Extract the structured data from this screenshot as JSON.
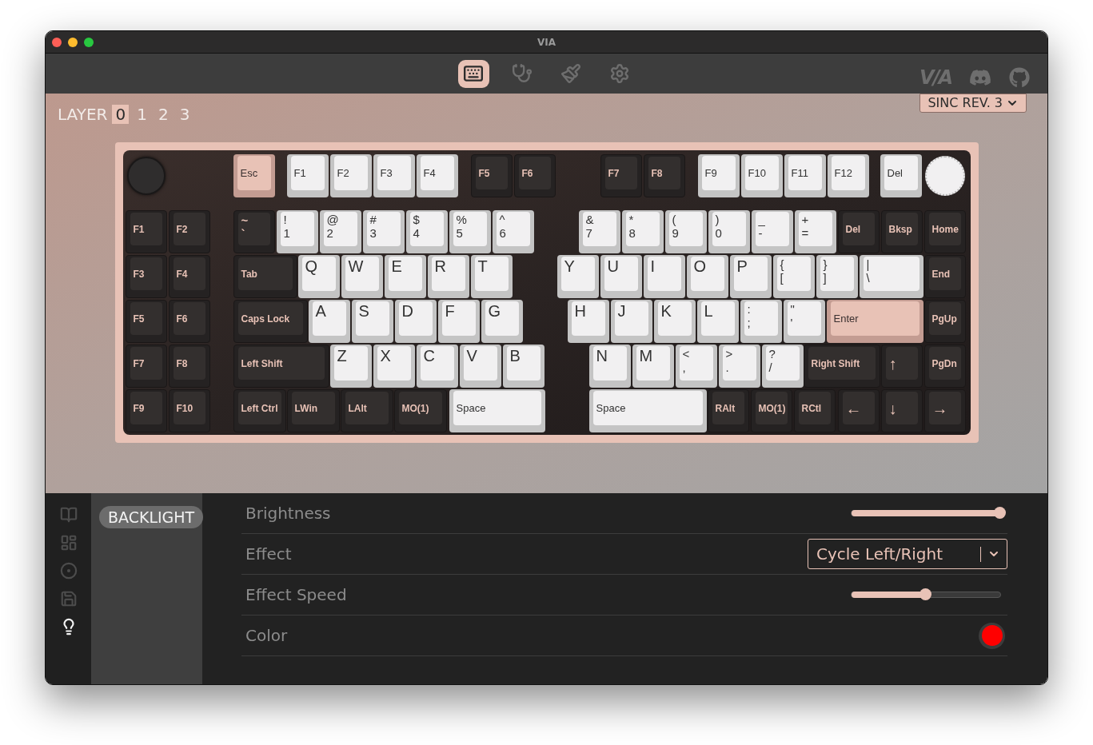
{
  "window": {
    "title": "VIA"
  },
  "nav": {
    "tabs": [
      {
        "kind": "keyboard",
        "selected": true
      },
      {
        "kind": "stethoscope",
        "selected": false
      },
      {
        "kind": "brush",
        "selected": false
      },
      {
        "kind": "settings",
        "selected": false
      }
    ],
    "logo": "V/A"
  },
  "layers": {
    "label": "LAYER",
    "items": [
      {
        "label": "0",
        "selected": true
      },
      {
        "label": "1",
        "selected": false
      },
      {
        "label": "2",
        "selected": false
      },
      {
        "label": "3",
        "selected": false
      }
    ]
  },
  "device": {
    "label": "SINC REV. 3"
  },
  "keyboard": {
    "rows": [
      {
        "keys": [
          {
            "kind": "accent",
            "legends": [
              "Esc"
            ]
          },
          {
            "kind": "light",
            "legends": [
              "F1"
            ]
          },
          {
            "kind": "light",
            "legends": [
              "F2"
            ]
          },
          {
            "kind": "light",
            "legends": [
              "F3"
            ]
          },
          {
            "kind": "light",
            "legends": [
              "F4"
            ]
          },
          {
            "kind": "dark",
            "legends": [
              "F5"
            ]
          },
          {
            "kind": "dark",
            "legends": [
              "F6"
            ]
          },
          {
            "kind": "dark",
            "legends": [
              "F7"
            ]
          },
          {
            "kind": "dark",
            "legends": [
              "F8"
            ]
          },
          {
            "kind": "light",
            "legends": [
              "F9"
            ]
          },
          {
            "kind": "light",
            "legends": [
              "F10"
            ]
          },
          {
            "kind": "light",
            "legends": [
              "F11"
            ]
          },
          {
            "kind": "light",
            "legends": [
              "F12"
            ]
          },
          {
            "kind": "light",
            "legends": [
              "Del"
            ]
          }
        ]
      },
      {
        "keys": [
          {
            "kind": "dark",
            "legends": [
              "F1"
            ]
          },
          {
            "kind": "dark",
            "legends": [
              "F2"
            ]
          },
          {
            "kind": "dark",
            "legends": [
              "~",
              "`"
            ]
          },
          {
            "kind": "light",
            "legends": [
              "!",
              "1"
            ]
          },
          {
            "kind": "light",
            "legends": [
              "@",
              "2"
            ]
          },
          {
            "kind": "light",
            "legends": [
              "#",
              "3"
            ]
          },
          {
            "kind": "light",
            "legends": [
              "$",
              "4"
            ]
          },
          {
            "kind": "light",
            "legends": [
              "%",
              "5"
            ]
          },
          {
            "kind": "light",
            "legends": [
              "^",
              "6"
            ]
          },
          {
            "kind": "light",
            "legends": [
              "&",
              "7"
            ]
          },
          {
            "kind": "light",
            "legends": [
              "*",
              "8"
            ]
          },
          {
            "kind": "light",
            "legends": [
              "(",
              "9"
            ]
          },
          {
            "kind": "light",
            "legends": [
              ")",
              "0"
            ]
          },
          {
            "kind": "light",
            "legends": [
              "_",
              "-"
            ]
          },
          {
            "kind": "light",
            "legends": [
              "+",
              "="
            ]
          },
          {
            "kind": "dark",
            "legends": [
              "Del"
            ]
          },
          {
            "kind": "dark",
            "legends": [
              "Bksp"
            ]
          },
          {
            "kind": "dark",
            "legends": [
              "Home"
            ]
          }
        ]
      },
      {
        "keys": [
          {
            "kind": "dark",
            "legends": [
              "F3"
            ]
          },
          {
            "kind": "dark",
            "legends": [
              "F4"
            ]
          },
          {
            "kind": "dark",
            "legends": [
              "Tab"
            ]
          },
          {
            "kind": "letter",
            "legends": [
              "Q"
            ]
          },
          {
            "kind": "letter",
            "legends": [
              "W"
            ]
          },
          {
            "kind": "letter",
            "legends": [
              "E"
            ]
          },
          {
            "kind": "letter",
            "legends": [
              "R"
            ]
          },
          {
            "kind": "letter",
            "legends": [
              "T"
            ]
          },
          {
            "kind": "letter",
            "legends": [
              "Y"
            ]
          },
          {
            "kind": "letter",
            "legends": [
              "U"
            ]
          },
          {
            "kind": "letter",
            "legends": [
              "I"
            ]
          },
          {
            "kind": "letter",
            "legends": [
              "O"
            ]
          },
          {
            "kind": "letter",
            "legends": [
              "P"
            ]
          },
          {
            "kind": "light",
            "legends": [
              "{",
              "["
            ]
          },
          {
            "kind": "light",
            "legends": [
              "}",
              "]"
            ]
          },
          {
            "kind": "light",
            "legends": [
              "|",
              "\\"
            ]
          },
          {
            "kind": "dark",
            "legends": [
              "End"
            ]
          }
        ]
      },
      {
        "keys": [
          {
            "kind": "dark",
            "legends": [
              "F5"
            ]
          },
          {
            "kind": "dark",
            "legends": [
              "F6"
            ]
          },
          {
            "kind": "dark",
            "legends": [
              "Caps Lock"
            ]
          },
          {
            "kind": "letter",
            "legends": [
              "A"
            ]
          },
          {
            "kind": "letter",
            "legends": [
              "S"
            ]
          },
          {
            "kind": "letter",
            "legends": [
              "D"
            ]
          },
          {
            "kind": "letter",
            "legends": [
              "F"
            ]
          },
          {
            "kind": "letter",
            "legends": [
              "G"
            ]
          },
          {
            "kind": "letter",
            "legends": [
              "H"
            ]
          },
          {
            "kind": "letter",
            "legends": [
              "J"
            ]
          },
          {
            "kind": "letter",
            "legends": [
              "K"
            ]
          },
          {
            "kind": "letter",
            "legends": [
              "L"
            ]
          },
          {
            "kind": "light",
            "legends": [
              ":",
              ";"
            ]
          },
          {
            "kind": "light",
            "legends": [
              "\"",
              "'"
            ]
          },
          {
            "kind": "accent",
            "legends": [
              "Enter"
            ]
          },
          {
            "kind": "dark",
            "legends": [
              "PgUp"
            ]
          }
        ]
      },
      {
        "keys": [
          {
            "kind": "dark",
            "legends": [
              "F7"
            ]
          },
          {
            "kind": "dark",
            "legends": [
              "F8"
            ]
          },
          {
            "kind": "dark",
            "legends": [
              "Left Shift"
            ]
          },
          {
            "kind": "letter",
            "legends": [
              "Z"
            ]
          },
          {
            "kind": "letter",
            "legends": [
              "X"
            ]
          },
          {
            "kind": "letter",
            "legends": [
              "C"
            ]
          },
          {
            "kind": "letter",
            "legends": [
              "V"
            ]
          },
          {
            "kind": "letter",
            "legends": [
              "B"
            ]
          },
          {
            "kind": "letter",
            "legends": [
              "N"
            ]
          },
          {
            "kind": "letter",
            "legends": [
              "M"
            ]
          },
          {
            "kind": "light",
            "legends": [
              "<",
              ","
            ]
          },
          {
            "kind": "light",
            "legends": [
              ">",
              "."
            ]
          },
          {
            "kind": "light",
            "legends": [
              "?",
              "/"
            ]
          },
          {
            "kind": "dark",
            "legends": [
              "Right Shift"
            ]
          },
          {
            "kind": "arrow",
            "legends": [
              "↑"
            ]
          },
          {
            "kind": "dark",
            "legends": [
              "PgDn"
            ]
          }
        ]
      },
      {
        "keys": [
          {
            "kind": "dark",
            "legends": [
              "F9"
            ]
          },
          {
            "kind": "dark",
            "legends": [
              "F10"
            ]
          },
          {
            "kind": "dark",
            "legends": [
              "Left Ctrl"
            ]
          },
          {
            "kind": "dark",
            "legends": [
              "LWin"
            ]
          },
          {
            "kind": "dark",
            "legends": [
              "LAlt"
            ]
          },
          {
            "kind": "dark",
            "legends": [
              "MO(1)"
            ]
          },
          {
            "kind": "light",
            "legends": [
              "Space"
            ]
          },
          {
            "kind": "light",
            "legends": [
              "Space"
            ]
          },
          {
            "kind": "dark",
            "legends": [
              "RAlt"
            ]
          },
          {
            "kind": "dark",
            "legends": [
              "MO(1)"
            ]
          },
          {
            "kind": "dark",
            "legends": [
              "RCtl"
            ]
          },
          {
            "kind": "arrow",
            "legends": [
              "←"
            ]
          },
          {
            "kind": "arrow",
            "legends": [
              "↓"
            ]
          },
          {
            "kind": "arrow",
            "legends": [
              "→"
            ]
          }
        ]
      }
    ]
  },
  "sidebar": {
    "items": [
      {
        "kind": "book",
        "selected": false
      },
      {
        "kind": "layout",
        "selected": false
      },
      {
        "kind": "target",
        "selected": false
      },
      {
        "kind": "save",
        "selected": false
      },
      {
        "kind": "bulb",
        "selected": true
      }
    ]
  },
  "menu": {
    "items": [
      {
        "label": "BACKLIGHT",
        "selected": true
      }
    ]
  },
  "settings": [
    {
      "kind": "slider",
      "label": "Brightness",
      "level": 1
    },
    {
      "kind": "select",
      "label": "Effect",
      "value": "Cycle Left/Right"
    },
    {
      "kind": "slider",
      "label": "Effect Speed",
      "level": 0.5
    },
    {
      "kind": "color",
      "label": "Color",
      "color": "#ff0000"
    }
  ]
}
